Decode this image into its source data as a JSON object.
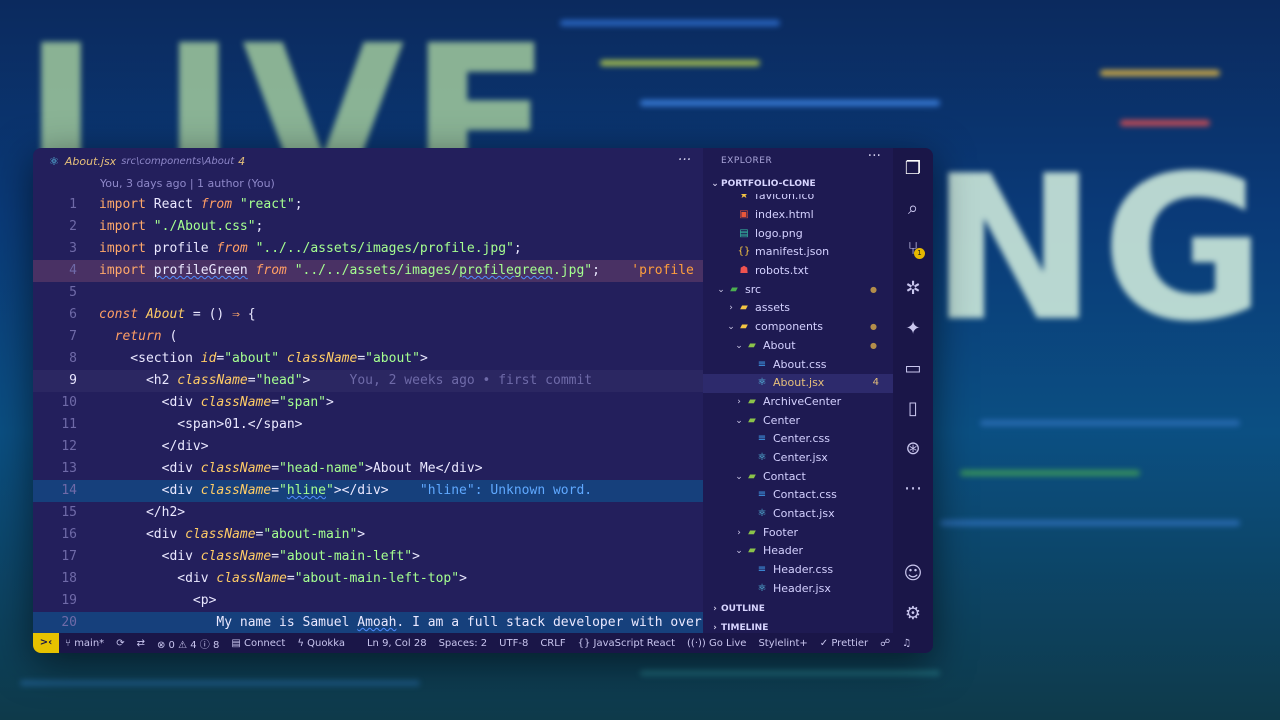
{
  "background": {
    "big_left": "LIVE",
    "big_right": "NG"
  },
  "tab": {
    "icon": "react-icon",
    "filename": "About.jsx",
    "path": "src\\components\\About",
    "problems": "4",
    "more": "···"
  },
  "blame_header": "You, 3 days ago | 1 author (You)",
  "code": {
    "l1": {
      "n": "1"
    },
    "l2": {
      "n": "2"
    },
    "l3": {
      "n": "3"
    },
    "l4": {
      "n": "4",
      "trail": "'profile"
    },
    "l5": {
      "n": "5"
    },
    "l6": {
      "n": "6"
    },
    "l7": {
      "n": "7"
    },
    "l8": {
      "n": "8"
    },
    "l9": {
      "n": "9",
      "ghost": "You, 2 weeks ago • first commit"
    },
    "l10": {
      "n": "10"
    },
    "l11": {
      "n": "11"
    },
    "l12": {
      "n": "12"
    },
    "l13": {
      "n": "13"
    },
    "l14": {
      "n": "14",
      "diag": "\"hline\": Unknown word."
    },
    "l15": {
      "n": "15"
    },
    "l16": {
      "n": "16"
    },
    "l17": {
      "n": "17"
    },
    "l18": {
      "n": "18"
    },
    "l19": {
      "n": "19"
    },
    "l20": {
      "n": "20"
    }
  },
  "explorer": {
    "title": "EXPLORER",
    "more": "···",
    "project": "PORTFOLIO-CLONE",
    "items": [
      {
        "label": "favicon.ico",
        "icon": "star-icon"
      },
      {
        "label": "index.html",
        "icon": "html5-icon"
      },
      {
        "label": "logo.png",
        "icon": "image-icon"
      },
      {
        "label": "manifest.json",
        "icon": "json-icon"
      },
      {
        "label": "robots.txt",
        "icon": "robot-icon"
      },
      {
        "label": "src",
        "icon": "folder-icon"
      },
      {
        "label": "assets",
        "icon": "folder-icon"
      },
      {
        "label": "components",
        "icon": "folder-open-icon"
      },
      {
        "label": "About",
        "icon": "folder-open-icon"
      },
      {
        "label": "About.css",
        "icon": "css-icon"
      },
      {
        "label": "About.jsx",
        "icon": "react-icon",
        "badge": "4"
      },
      {
        "label": "ArchiveCenter",
        "icon": "folder-icon"
      },
      {
        "label": "Center",
        "icon": "folder-open-icon"
      },
      {
        "label": "Center.css",
        "icon": "css-icon"
      },
      {
        "label": "Center.jsx",
        "icon": "react-icon"
      },
      {
        "label": "Contact",
        "icon": "folder-open-icon"
      },
      {
        "label": "Contact.css",
        "icon": "css-icon"
      },
      {
        "label": "Contact.jsx",
        "icon": "react-icon"
      },
      {
        "label": "Footer",
        "icon": "folder-icon"
      },
      {
        "label": "Header",
        "icon": "folder-open-icon"
      },
      {
        "label": "Header.css",
        "icon": "css-icon"
      },
      {
        "label": "Header.jsx",
        "icon": "react-icon"
      }
    ],
    "outline": "OUTLINE",
    "timeline": "TIMELINE"
  },
  "activity": {
    "scm_badge": "1"
  },
  "status": {
    "remote": ">‹",
    "branch": "main*",
    "errors": "⊗ 0",
    "warnings": "⚠ 4",
    "infos": "ⓘ 8",
    "connect": "Connect",
    "quokka": "Quokka",
    "position": "Ln 9, Col 28",
    "spaces": "Spaces: 2",
    "encoding": "UTF-8",
    "eol": "CRLF",
    "language": "JavaScript React",
    "golive": "Go Live",
    "stylelint": "Stylelint+",
    "prettier": "Prettier"
  },
  "colors": {
    "editor_bg": "#231f5c",
    "sidebar_bg": "#1e1a52",
    "keyword": "#ffa86a",
    "string": "#a5ff90",
    "attribute": "#ffcc66",
    "remote_badge": "#e6c200"
  }
}
